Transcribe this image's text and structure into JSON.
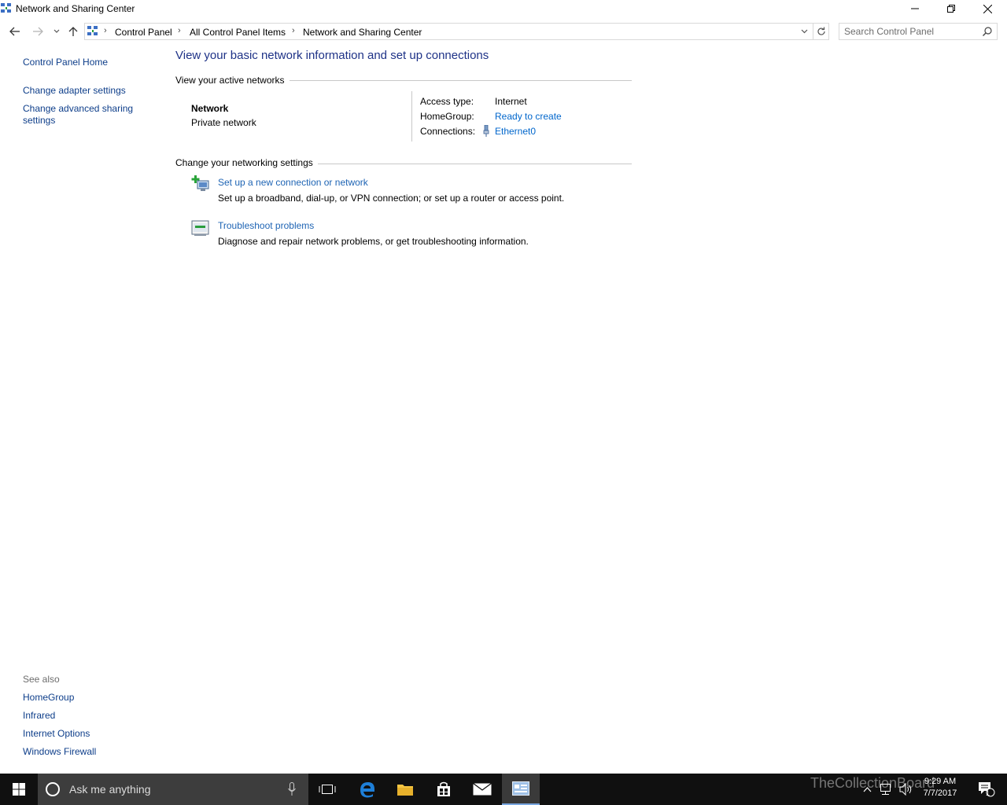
{
  "window": {
    "title": "Network and Sharing Center"
  },
  "address": {
    "breadcrumbs": [
      "Control Panel",
      "All Control Panel Items",
      "Network and Sharing Center"
    ],
    "search_placeholder": "Search Control Panel"
  },
  "left_pane": {
    "items": [
      "Control Panel Home",
      "Change adapter settings",
      "Change advanced sharing",
      "settings"
    ],
    "see_also_label": "See also",
    "see_also": [
      "HomeGroup",
      "Infrared",
      "Internet Options",
      "Windows Firewall"
    ]
  },
  "main": {
    "heading": "View your basic network information and set up connections",
    "active_networks_title": "View your active networks",
    "network_name": "Network",
    "network_type": "Private network",
    "access_type_label": "Access type:",
    "access_type_value": "Internet",
    "homegroup_label": "HomeGroup:",
    "homegroup_value": "Ready to create",
    "connections_label": "Connections:",
    "connections_value": "Ethernet0",
    "change_settings_title": "Change your networking settings",
    "tasks": [
      {
        "title": "Set up a new connection or network",
        "desc": "Set up a broadband, dial-up, or VPN connection; or set up a router or access point.",
        "icon": "new-connection-icon"
      },
      {
        "title": "Troubleshoot problems",
        "desc": "Diagnose and repair network problems, or get troubleshooting information.",
        "icon": "troubleshoot-icon"
      }
    ]
  },
  "taskbar": {
    "search_text": "Ask me anything",
    "time": "9:29 AM",
    "date": "7/7/2017",
    "notification_count": "1",
    "watermark": "TheCollectionBoard"
  },
  "colors": {
    "link": "#0066cc",
    "heading": "#1e3287",
    "taskbar": "#101010"
  }
}
